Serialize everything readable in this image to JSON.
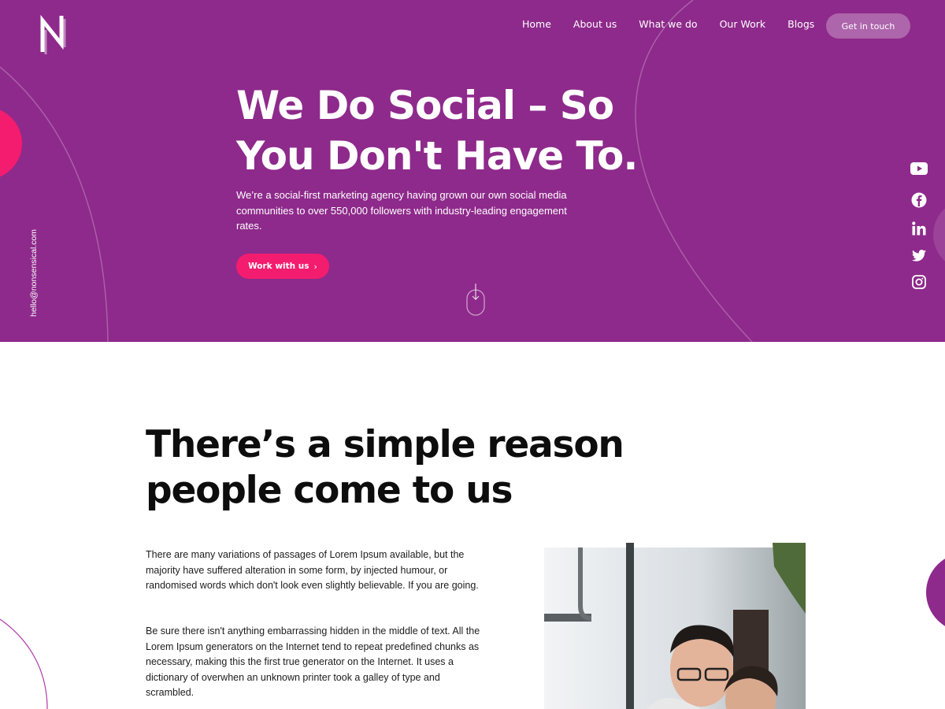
{
  "brand": {
    "logo": "nonsensical-logo",
    "accent": "#f41c6e",
    "hero_bg": "#8e2a8b"
  },
  "nav": {
    "items": [
      "Home",
      "About us",
      "What we do",
      "Our Work",
      "Blogs"
    ],
    "cta": "Get in touch"
  },
  "hero": {
    "title": "We Do Social – So You Don't Have To.",
    "subtitle": "We’re a social-first marketing agency having grown our own social media communities to over 550,000 followers with industry-leading engagement rates.",
    "button": "Work with us",
    "email": "hello@nonsensical.com"
  },
  "socials": [
    "youtube-icon",
    "facebook-icon",
    "linkedin-icon",
    "twitter-icon",
    "instagram-icon"
  ],
  "section": {
    "title": "There’s a simple reason people come to us",
    "paragraphs": [
      "There are many variations of passages of Lorem Ipsum available, but the majority have suffered alteration in some form, by injected humour, or randomised words which don't look even slightly believable. If you are going.",
      "Be sure there isn't anything embarrassing hidden in the middle of text. All the Lorem Ipsum generators on the Internet tend to repeat predefined chunks as necessary, making this the first true generator on the Internet. It uses a dictionary of overwhen an unknown printer took a galley of type and scrambled."
    ]
  }
}
